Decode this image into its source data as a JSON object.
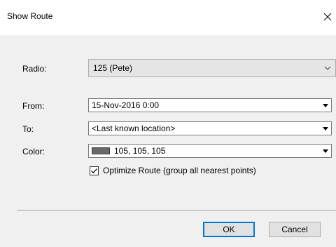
{
  "window": {
    "title": "Show Route"
  },
  "form": {
    "radio": {
      "label": "Radio:",
      "value": "125 (Pete)"
    },
    "from": {
      "label": "From:",
      "value": "15-Nov-2016 0:00"
    },
    "to": {
      "label": "To:",
      "value": "<Last known location>"
    },
    "color": {
      "label": "Color:",
      "value": "105, 105, 105",
      "swatch": "#696969"
    },
    "optimize": {
      "label": "Optimize Route (group all nearest points)",
      "checked": true
    }
  },
  "buttons": {
    "ok": "OK",
    "cancel": "Cancel"
  },
  "icons": {
    "close": "close-icon",
    "chevron": "chevron-down-icon",
    "dropdown_arrow": "dropdown-arrow-icon",
    "checkmark": "checkmark-icon"
  },
  "colors": {
    "dialog_background": "#f0f0f0",
    "title_background": "#ffffff",
    "default_button_border": "#0078d7"
  }
}
